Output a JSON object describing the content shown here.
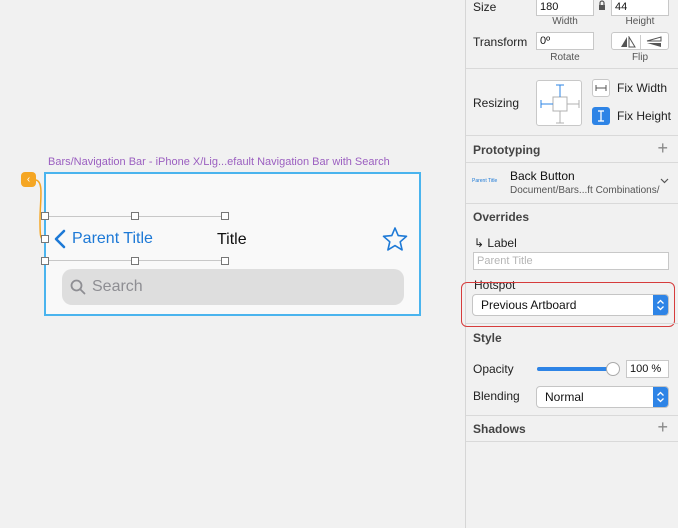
{
  "canvas": {
    "artboard_label": "Bars/Navigation Bar - iPhone X/Lig...efault Navigation Bar with Search",
    "nav_back_label": "Parent Title",
    "nav_title": "Title",
    "search_placeholder": "Search"
  },
  "inspector": {
    "size": {
      "label": "Size",
      "width": "180",
      "height": "44",
      "width_caption": "Width",
      "height_caption": "Height"
    },
    "transform": {
      "label": "Transform",
      "rotate": "0º",
      "rotate_caption": "Rotate",
      "flip_caption": "Flip"
    },
    "resizing": {
      "label": "Resizing",
      "fix_width": "Fix Width",
      "fix_height": "Fix Height",
      "fix_width_checked": false,
      "fix_height_checked": true
    },
    "prototyping": {
      "title": "Prototyping",
      "thumb_text": "Parent Title",
      "symbol_name": "Back Button",
      "symbol_path": "Document/Bars...ft Combinations/"
    },
    "overrides": {
      "title": "Overrides",
      "label_heading": "↳ Label",
      "label_placeholder": "Parent Title",
      "hotspot_heading": "Hotspot",
      "hotspot_value": "Previous Artboard"
    },
    "style": {
      "title": "Style",
      "opacity_label": "Opacity",
      "opacity_value": "100 %",
      "opacity_level": 1.0,
      "blending_label": "Blending",
      "blending_value": "Normal"
    },
    "shadows": {
      "title": "Shadows"
    }
  },
  "colors": {
    "accent": "#2e84e6",
    "ios_blue": "#1d79d6",
    "selection": "#4ab4ee",
    "artboard_label": "#9b5fc0",
    "proto_badge": "#f5a623",
    "highlight": "#d63c3c"
  }
}
